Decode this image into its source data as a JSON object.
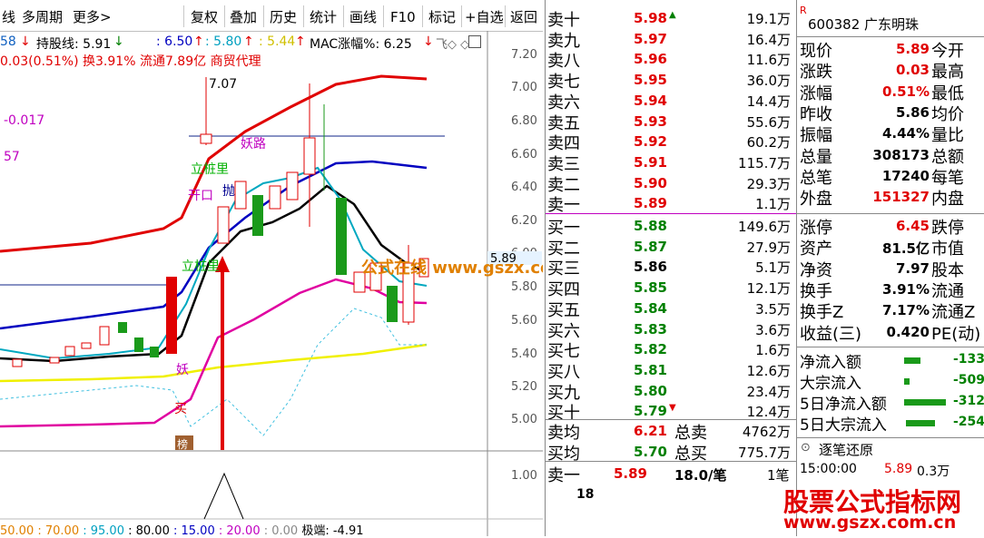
{
  "toolbar": {
    "left_labels": [
      "线",
      "多周期",
      "更多>"
    ],
    "buttons": [
      "复权",
      "叠加",
      "历史",
      "统计",
      "画线",
      "F10",
      "标记",
      "+自选",
      "返回"
    ]
  },
  "info": {
    "row1": [
      "58",
      "持股线: 5.91",
      ": 6.50",
      ": 5.80",
      ": 5.44",
      "MAC涨幅%: 6.25"
    ],
    "row2": "0.03(0.51%) 换3.91% 流通7.89亿 商贸代理"
  },
  "chart_labels": {
    "high": "7.07",
    "neg": "-0.017",
    "num57": "57",
    "yaolu": "妖路",
    "lizhuangli1": "立桩里",
    "lizhuangli2": "立桩里",
    "kaikou": "开口",
    "pao": "抛",
    "yao": "妖",
    "mai": "买",
    "bang": "榜",
    "watermark": "公式在线  www.gszx.com.cn",
    "current_price": "5.89"
  },
  "price_axis": [
    "7.20",
    "7.00",
    "6.80",
    "6.60",
    "6.40",
    "6.20",
    "6.00",
    "5.80",
    "5.60",
    "5.40",
    "5.20",
    "5.00"
  ],
  "sub_axis": [
    "1.00"
  ],
  "bottom_indicator": [
    "50.00",
    ": 70.00",
    ": 95.00",
    ": 80.00",
    ": 15.00",
    ": 20.00",
    ": 0.00",
    "极端: -4.91"
  ],
  "orderbook": {
    "asks": [
      {
        "label": "卖十",
        "price": "5.98",
        "vol": "19.1万"
      },
      {
        "label": "卖九",
        "price": "5.97",
        "vol": "16.4万"
      },
      {
        "label": "卖八",
        "price": "5.96",
        "vol": "11.6万"
      },
      {
        "label": "卖七",
        "price": "5.95",
        "vol": "36.0万"
      },
      {
        "label": "卖六",
        "price": "5.94",
        "vol": "14.4万"
      },
      {
        "label": "卖五",
        "price": "5.93",
        "vol": "55.6万"
      },
      {
        "label": "卖四",
        "price": "5.92",
        "vol": "60.2万"
      },
      {
        "label": "卖三",
        "price": "5.91",
        "vol": "115.7万"
      },
      {
        "label": "卖二",
        "price": "5.90",
        "vol": "29.3万"
      },
      {
        "label": "卖一",
        "price": "5.89",
        "vol": "1.1万"
      }
    ],
    "bids": [
      {
        "label": "买一",
        "price": "5.88",
        "vol": "149.6万"
      },
      {
        "label": "买二",
        "price": "5.87",
        "vol": "27.9万"
      },
      {
        "label": "买三",
        "price": "5.86",
        "vol": "5.1万"
      },
      {
        "label": "买四",
        "price": "5.85",
        "vol": "12.1万"
      },
      {
        "label": "买五",
        "price": "5.84",
        "vol": "3.5万"
      },
      {
        "label": "买六",
        "price": "5.83",
        "vol": "3.6万"
      },
      {
        "label": "买七",
        "price": "5.82",
        "vol": "1.6万"
      },
      {
        "label": "买八",
        "price": "5.81",
        "vol": "12.6万"
      },
      {
        "label": "买九",
        "price": "5.80",
        "vol": "23.4万"
      },
      {
        "label": "买十",
        "price": "5.79",
        "vol": "12.4万"
      }
    ],
    "avg_sell_label": "卖均",
    "avg_sell": "6.21",
    "total_sell_label": "总卖",
    "total_sell": "4762万",
    "avg_buy_label": "买均",
    "avg_buy": "5.70",
    "total_buy_label": "总买",
    "total_buy": "775.7万",
    "last_label": "卖一",
    "last_price": "5.89",
    "last_vol": "18.0/笔",
    "last_count": "1笔",
    "last_num": "18"
  },
  "quote": {
    "r_badge": "R",
    "code_name": "600382 广东明珠",
    "rows1": [
      {
        "l": "现价",
        "v": "5.89",
        "r": "今开",
        "c": "red"
      },
      {
        "l": "涨跌",
        "v": "0.03",
        "r": "最高",
        "c": "red"
      },
      {
        "l": "涨幅",
        "v": "0.51%",
        "r": "最低",
        "c": "red"
      },
      {
        "l": "昨收",
        "v": "5.86",
        "r": "均价",
        "c": "blk"
      },
      {
        "l": "振幅",
        "v": "4.44%",
        "r": "量比",
        "c": "blk"
      },
      {
        "l": "总量",
        "v": "308173",
        "r": "总额",
        "c": "blk"
      },
      {
        "l": "总笔",
        "v": "17240",
        "r": "每笔",
        "c": "blk"
      },
      {
        "l": "外盘",
        "v": "151327",
        "r": "内盘",
        "c": "red"
      }
    ],
    "rows2": [
      {
        "l": "涨停",
        "v": "6.45",
        "r": "跌停",
        "c": "red"
      },
      {
        "l": "资产",
        "v": "81.5亿",
        "r": "市值",
        "c": "blk"
      },
      {
        "l": "净资",
        "v": "7.97",
        "r": "股本",
        "c": "blk"
      },
      {
        "l": "换手",
        "v": "3.91%",
        "r": "流通",
        "c": "blk"
      },
      {
        "l": "换手Z",
        "v": "7.17%",
        "r": "流通Z",
        "c": "blk"
      },
      {
        "l": "收益(三)",
        "v": "0.420",
        "r": "PE(动)",
        "c": "blk"
      }
    ],
    "flows": [
      {
        "l": "净流入额",
        "v": "-133"
      },
      {
        "l": "大宗流入",
        "v": "-509"
      },
      {
        "l": "5日净流入额",
        "v": "-312"
      },
      {
        "l": "5日大宗流入",
        "v": "-254"
      }
    ],
    "tick_title": "逐笔还原",
    "tick_time": "15:00:00",
    "tick_price": "5.89",
    "tick_vol": "0.3万",
    "logo_text": "股票公式指标网",
    "logo_url": "www.gszx.com.cn"
  }
}
